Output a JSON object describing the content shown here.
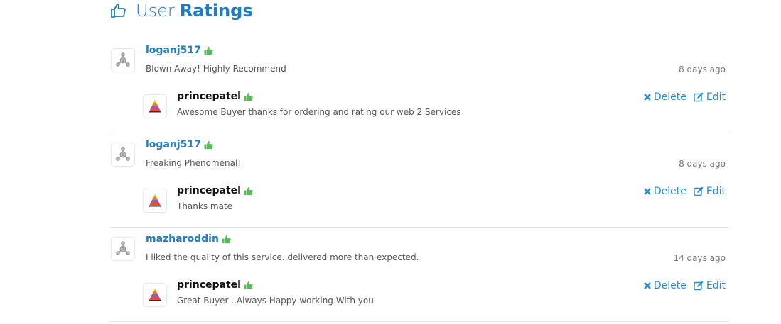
{
  "header": {
    "title_light": "User",
    "title_bold": "Ratings"
  },
  "reviews": [
    {
      "user": "loganj517",
      "comment": "Blown Away! Highly Recommend",
      "time": "8 days ago",
      "reply": {
        "seller": "princepatel",
        "text": "Awesome Buyer thanks for ordering and rating our web 2 Services"
      }
    },
    {
      "user": "loganj517",
      "comment": "Freaking Phenomenal!",
      "time": "8 days ago",
      "reply": {
        "seller": "princepatel",
        "text": "Thanks mate"
      }
    },
    {
      "user": "mazharoddin",
      "comment": "I liked the quality of this service..delivered more than expected.",
      "time": "14 days ago",
      "reply": {
        "seller": "princepatel",
        "text": "Great Buyer ..Always Happy working With you"
      }
    }
  ],
  "actions": {
    "delete_label": "Delete",
    "edit_label": "Edit"
  },
  "colors": {
    "accent": "#1f7cc0",
    "positive": "#5cb85c",
    "link": "#2a8ad1"
  },
  "icons": [
    "thumbs-up-icon",
    "user-avatar-icon",
    "seller-logo-icon",
    "delete-icon",
    "edit-icon"
  ]
}
